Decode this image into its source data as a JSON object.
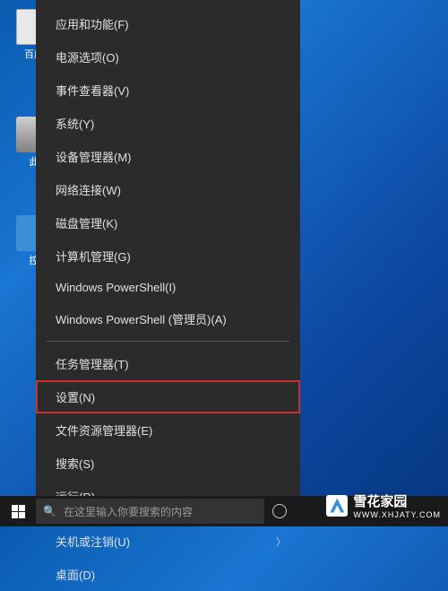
{
  "desktop": {
    "icons": [
      {
        "label": "百度"
      },
      {
        "label": "此"
      },
      {
        "label": "控"
      }
    ]
  },
  "menu": {
    "group1": [
      "应用和功能(F)",
      "电源选项(O)",
      "事件查看器(V)",
      "系统(Y)",
      "设备管理器(M)",
      "网络连接(W)",
      "磁盘管理(K)",
      "计算机管理(G)",
      "Windows PowerShell(I)",
      "Windows PowerShell (管理员)(A)"
    ],
    "group2": [
      "任务管理器(T)",
      "设置(N)",
      "文件资源管理器(E)",
      "搜索(S)",
      "运行(R)"
    ],
    "group3": [
      {
        "label": "关机或注销(U)",
        "submenu": true
      },
      {
        "label": "桌面(D)",
        "submenu": false
      }
    ],
    "highlighted_index": 1
  },
  "taskbar": {
    "search_placeholder": "在这里输入你要搜索的内容"
  },
  "watermark": {
    "title": "雪花家园",
    "sub": "WWW.XHJATY.COM"
  }
}
